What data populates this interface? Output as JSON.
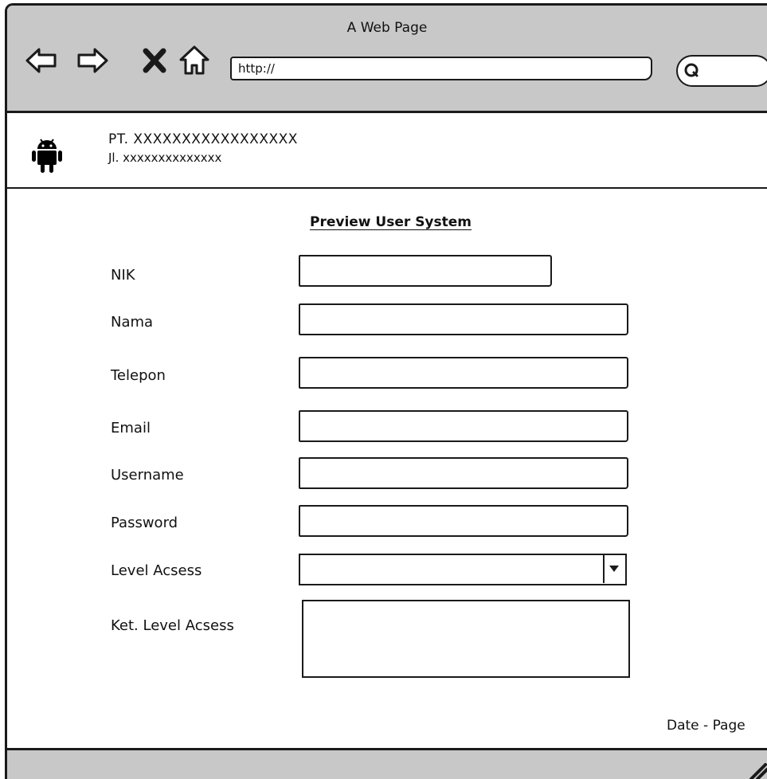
{
  "browser": {
    "window_title": "A Web Page",
    "url": "http://",
    "nav_icons": [
      "back-arrow-icon",
      "forward-arrow-icon",
      "stop-icon",
      "home-icon"
    ],
    "search_icon": "search-icon"
  },
  "company": {
    "logo_icon": "android-icon",
    "name": "PT. XXXXXXXXXXXXXXXXX",
    "address": "Jl. xxxxxxxxxxxxxx"
  },
  "form": {
    "title": "Preview User System",
    "fields": [
      {
        "label": "NIK",
        "value": ""
      },
      {
        "label": "Nama",
        "value": ""
      },
      {
        "label": "Telepon",
        "value": ""
      },
      {
        "label": "Email",
        "value": ""
      },
      {
        "label": "Username",
        "value": ""
      },
      {
        "label": "Password",
        "value": ""
      },
      {
        "label": "Level Acsess",
        "value": ""
      },
      {
        "label": "Ket. Level Acsess",
        "value": ""
      }
    ]
  },
  "footer": {
    "text": "Date - Page"
  },
  "colors": {
    "chrome": "#c8c8c8",
    "border": "#1a1a1a",
    "background": "#ffffff"
  }
}
